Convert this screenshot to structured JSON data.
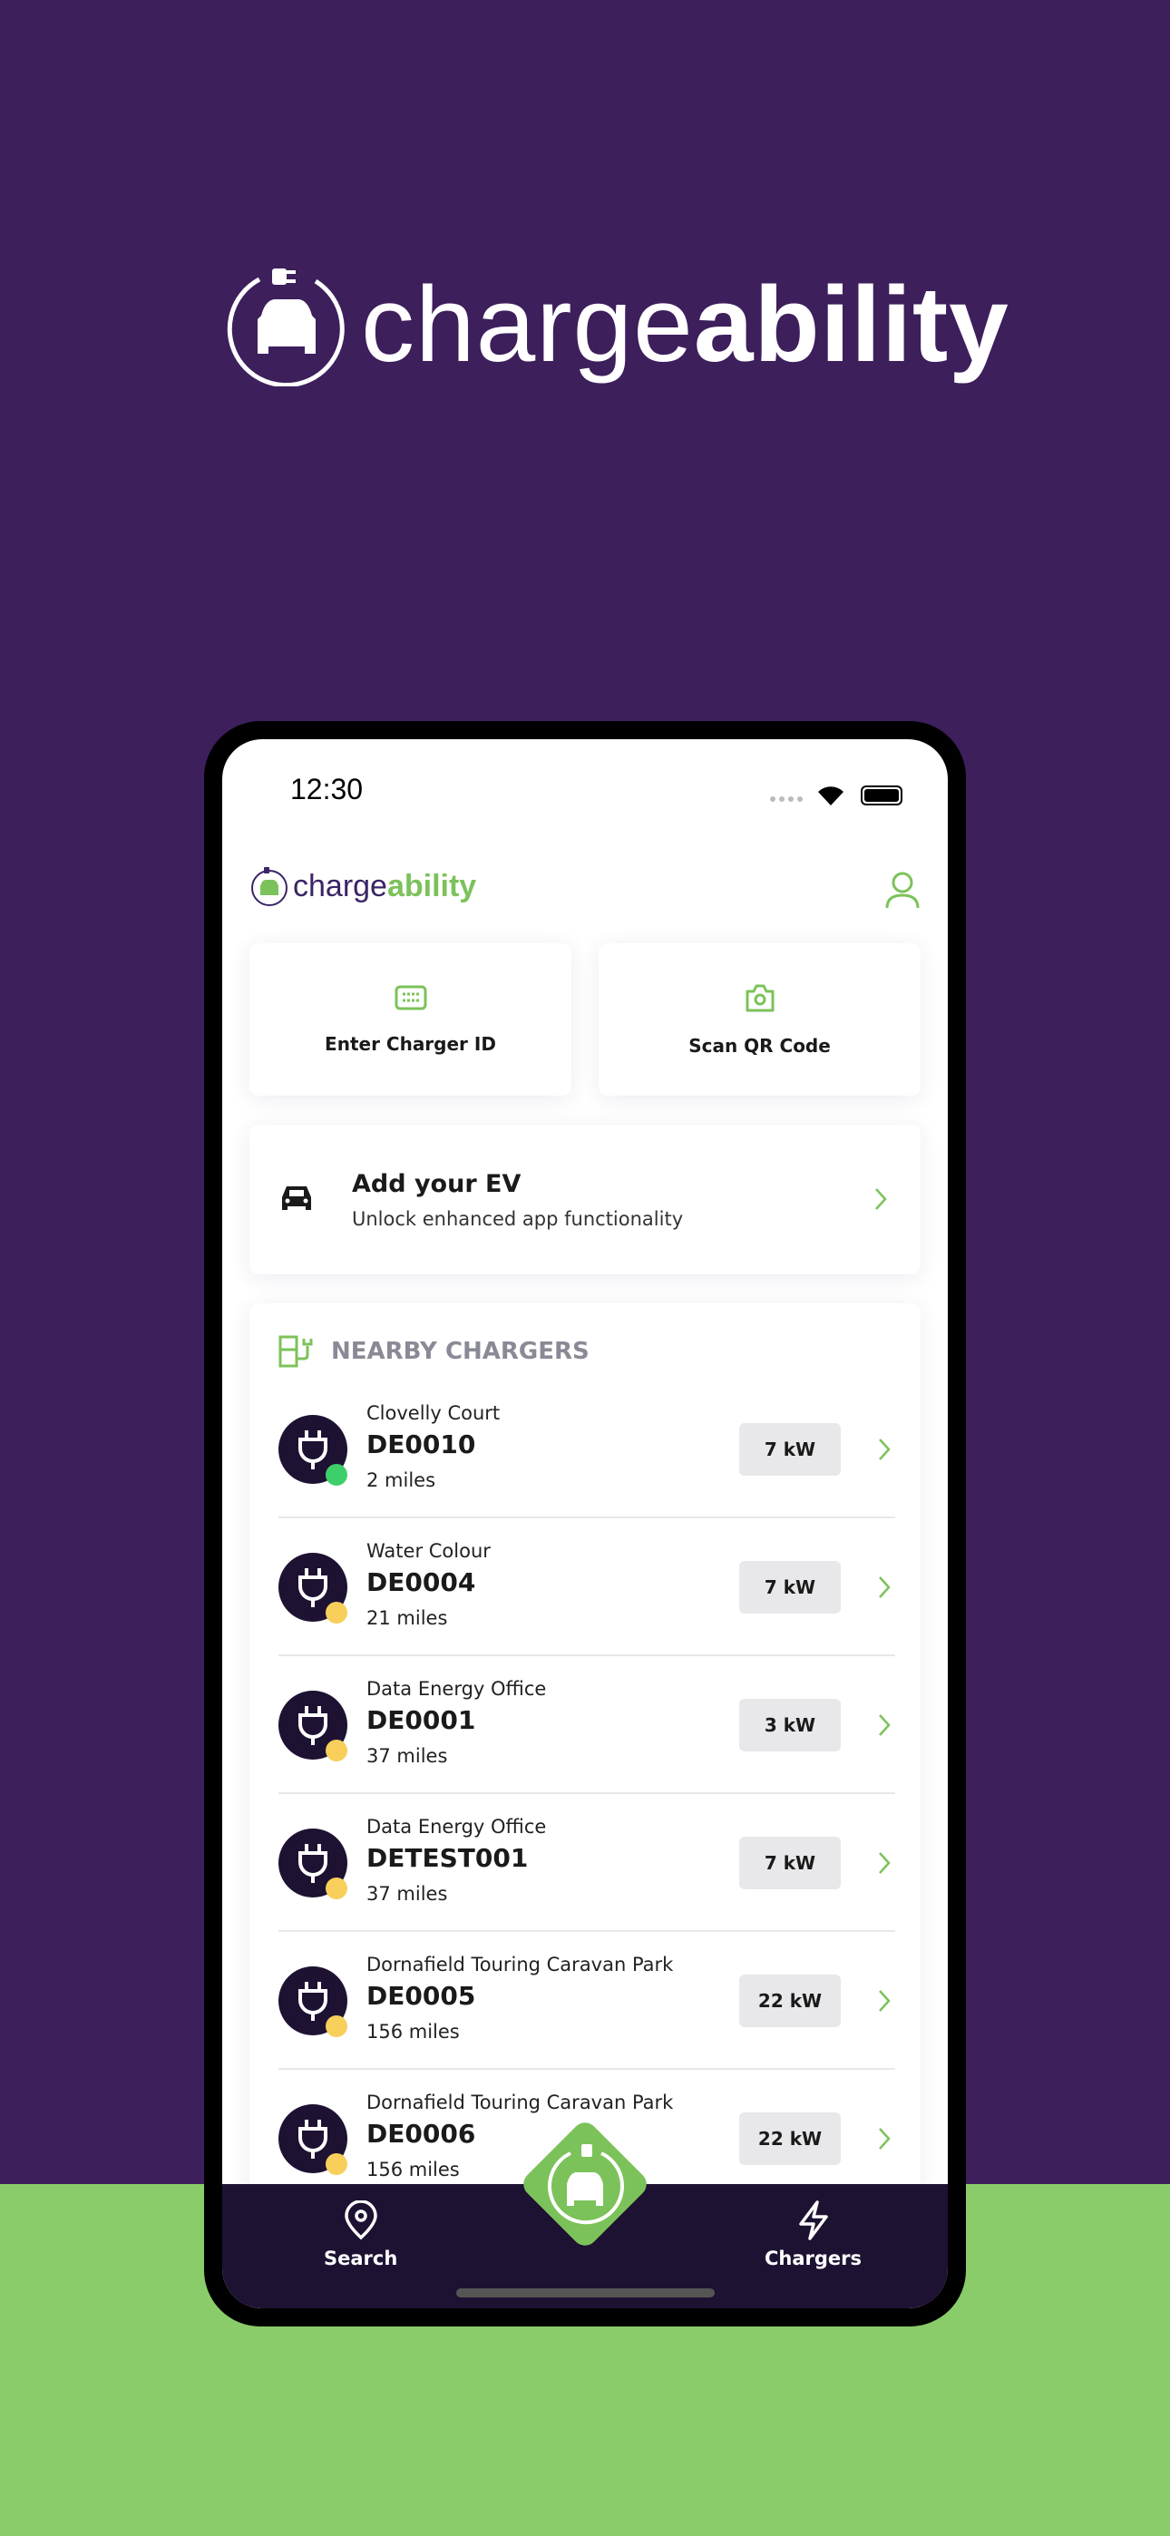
{
  "brand": {
    "name_light": "charge",
    "name_bold": "ability"
  },
  "status_bar": {
    "time": "12:30"
  },
  "actions": [
    {
      "label": "Enter Charger ID",
      "icon": "keyboard-icon"
    },
    {
      "label": "Scan QR Code",
      "icon": "camera-icon"
    }
  ],
  "add_ev": {
    "title": "Add your EV",
    "subtitle": "Unlock enhanced app functionality"
  },
  "nearby": {
    "title": "NEARBY CHARGERS",
    "items": [
      {
        "location": "Clovelly Court",
        "id": "DE0010",
        "distance": "2 miles",
        "power": "7 kW",
        "status_color": "#3dd06a"
      },
      {
        "location": "Water Colour",
        "id": "DE0004",
        "distance": "21 miles",
        "power": "7 kW",
        "status_color": "#f7cf5a"
      },
      {
        "location": "Data Energy Office",
        "id": "DE0001",
        "distance": "37 miles",
        "power": "3 kW",
        "status_color": "#f7cf5a"
      },
      {
        "location": "Data Energy Office",
        "id": "DETEST001",
        "distance": "37 miles",
        "power": "7 kW",
        "status_color": "#f7cf5a"
      },
      {
        "location": "Dornafield Touring Caravan Park",
        "id": "DE0005",
        "distance": "156 miles",
        "power": "22 kW",
        "status_color": "#f7cf5a"
      },
      {
        "location": "Dornafield Touring Caravan Park",
        "id": "DE0006",
        "distance": "156 miles",
        "power": "22 kW",
        "status_color": "#f7cf5a"
      }
    ]
  },
  "nav": {
    "search": "Search",
    "chargers": "Chargers"
  },
  "colors": {
    "purple_bg": "#3d1f5c",
    "green": "#7cc25a",
    "nav_dark": "#1e1233"
  }
}
